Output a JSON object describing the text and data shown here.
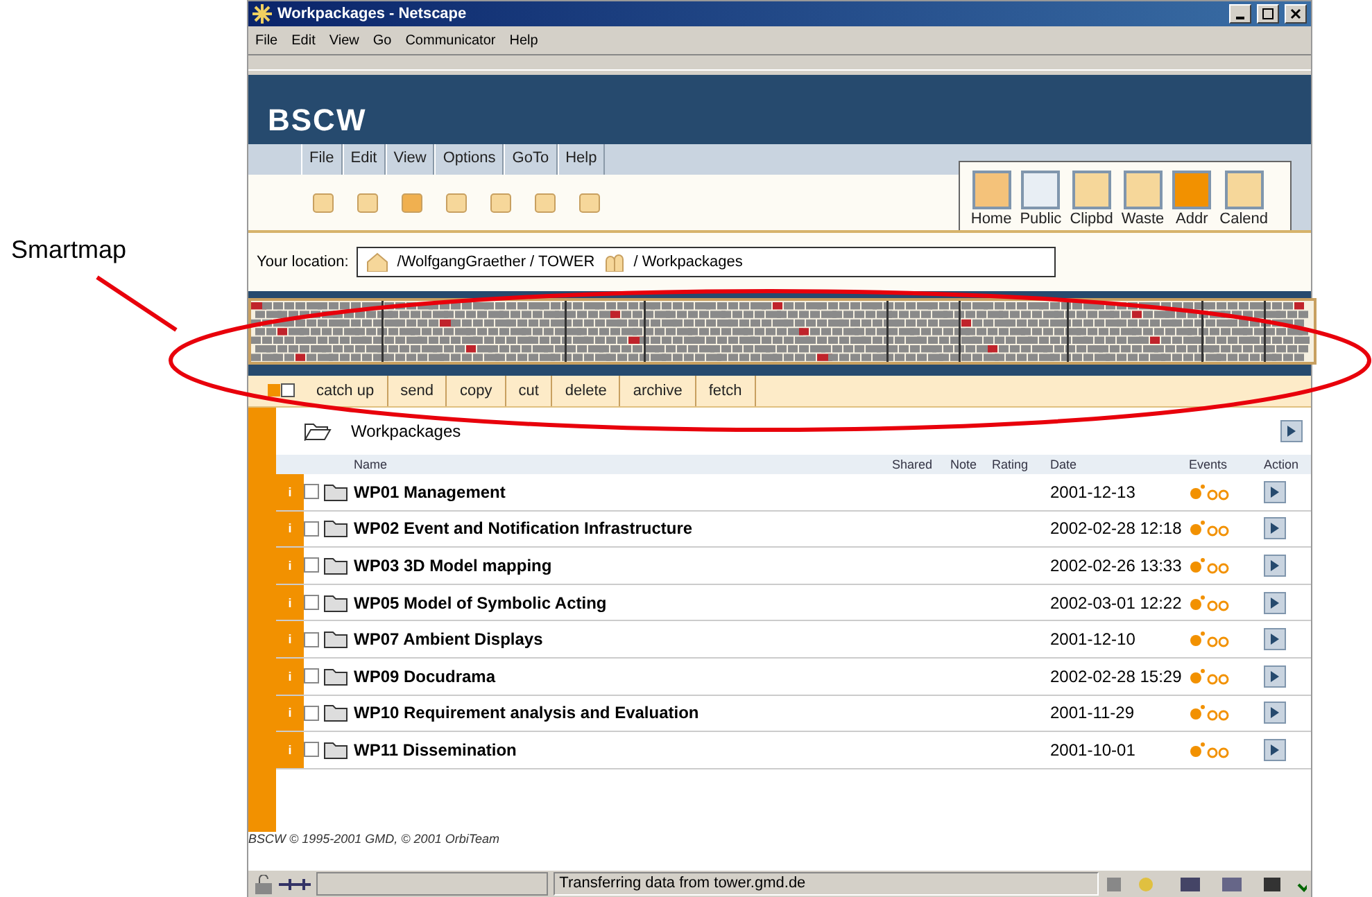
{
  "annotation": {
    "label": "Smartmap"
  },
  "window": {
    "title": "Workpackages - Netscape"
  },
  "menu_bar": [
    "File",
    "Edit",
    "View",
    "Go",
    "Communicator",
    "Help"
  ],
  "bscw": {
    "logo": "BSCW",
    "menus": [
      "File",
      "Edit",
      "View",
      "Options",
      "GoTo",
      "Help"
    ],
    "nav_buttons": [
      {
        "label": "Home",
        "kind": "home"
      },
      {
        "label": "Public",
        "kind": "public"
      },
      {
        "label": "Clipbd",
        "kind": "clipboard"
      },
      {
        "label": "Waste",
        "kind": "waste"
      },
      {
        "label": "Addr",
        "kind": "address"
      },
      {
        "label": "Calend",
        "kind": "calendar"
      }
    ],
    "location": {
      "label": "Your location:",
      "segments": [
        {
          "text": "/WolfgangGraether / TOWER",
          "kind": "home"
        },
        {
          "text": "/ Workpackages",
          "kind": "shared"
        }
      ]
    },
    "actions": [
      "catch up",
      "send",
      "copy",
      "cut",
      "delete",
      "archive",
      "fetch"
    ],
    "folder": {
      "title": "Workpackages"
    },
    "columns": [
      "Name",
      "Shared",
      "Note",
      "Rating",
      "Date",
      "Events",
      "Action"
    ],
    "rows": [
      {
        "info": "i",
        "name": "WP01 Management",
        "date": "2001-12-13",
        "checked": false
      },
      {
        "info": "i",
        "name": "WP02 Event and Notification Infrastructure",
        "date": "2002-02-28 12:18",
        "checked": false
      },
      {
        "info": "i",
        "name": "WP03 3D Model mapping",
        "date": "2002-02-26 13:33",
        "checked": false
      },
      {
        "info": "i",
        "name": "WP05 Model of Symbolic Acting",
        "date": "2002-03-01 12:22",
        "checked": false
      },
      {
        "info": "i",
        "name": "WP07 Ambient Displays",
        "date": "2001-12-10",
        "checked": false
      },
      {
        "info": "i",
        "name": "WP09 Docudrama",
        "date": "2002-02-28 15:29",
        "checked": false
      },
      {
        "info": "i",
        "name": "WP10 Requirement analysis and Evaluation",
        "date": "2001-11-29",
        "checked": false
      },
      {
        "info": "i",
        "name": "WP11 Dissemination",
        "date": "2001-10-01",
        "checked": false
      }
    ],
    "footer": "BSCW © 1995-2001 GMD, © 2001 OrbiTeam"
  },
  "status_bar": {
    "text": "Transferring data from tower.gmd.de"
  }
}
